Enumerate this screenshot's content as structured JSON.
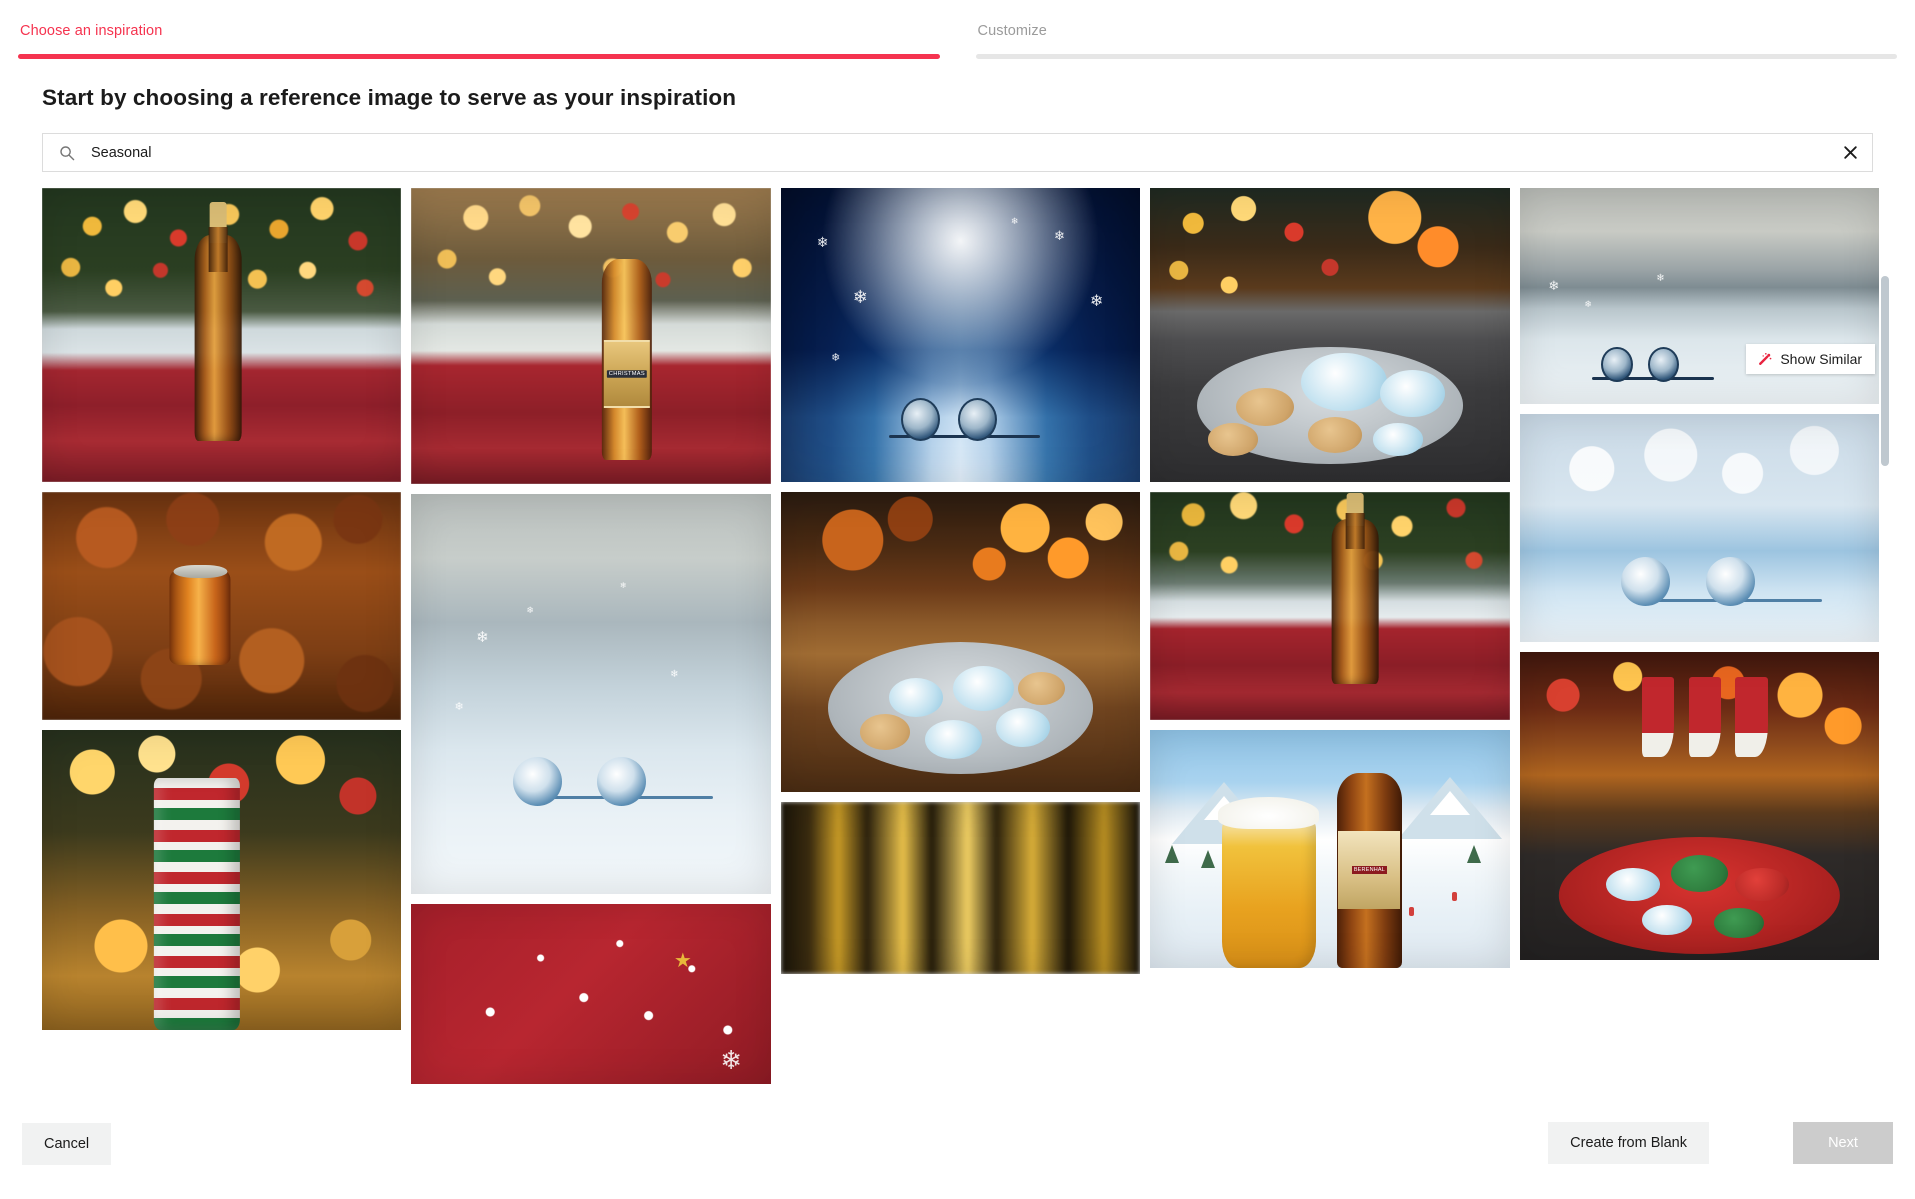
{
  "stepper": {
    "steps": [
      {
        "label": "Choose an inspiration",
        "state": "active",
        "accent": "#f5334f"
      },
      {
        "label": "Customize",
        "state": "inactive",
        "accent": "#e6e6e6"
      }
    ]
  },
  "page": {
    "title": "Start by choosing a reference image to serve as your inspiration"
  },
  "search": {
    "value": "Seasonal",
    "placeholder": "Search",
    "search_icon": "search-icon",
    "clear_icon": "close-icon",
    "clear_label": "Clear search"
  },
  "overlay": {
    "show_similar_label": "Show Similar",
    "show_similar_icon": "magic-wand-icon",
    "icon_color": "#e8233f"
  },
  "gallery": {
    "columns": [
      {
        "tiles": [
          {
            "name": "inspiration-tile-1",
            "alt": "Beer bottle on red plaid blanket in front of a lit Christmas tree"
          },
          {
            "name": "inspiration-tile-6",
            "alt": "Orange soda can nestled in autumn leaves"
          },
          {
            "name": "inspiration-tile-11",
            "alt": "Festive red and green patterned can with warm bokeh lights"
          }
        ]
      },
      {
        "tiles": [
          {
            "name": "inspiration-tile-2",
            "alt": "Christmas beer bottle with cookies and pinecones on plaid cloth",
            "label_text": "CHRISTMAS"
          },
          {
            "name": "inspiration-tile-7",
            "alt": "Earbuds lying in snow on a pale winter day"
          },
          {
            "name": "inspiration-tile-12",
            "alt": "Red holiday banner with ornaments, gold star and snowflake"
          }
        ]
      },
      {
        "tiles": [
          {
            "name": "inspiration-tile-3",
            "alt": "Blue snowy canyon with snowflakes and earbuds"
          },
          {
            "name": "inspiration-tile-8",
            "alt": "Plate of iced snowflake cookies by a fireplace and Christmas tree"
          },
          {
            "name": "inspiration-tile-13",
            "alt": "Blurred golden forest light"
          }
        ]
      },
      {
        "tiles": [
          {
            "name": "inspiration-tile-4",
            "alt": "Snowflake-iced cookies on a slate board with fireplace bokeh"
          },
          {
            "name": "inspiration-tile-9",
            "alt": "Beer bottle on plaid with cookies and Christmas tree lights"
          },
          {
            "name": "inspiration-tile-10",
            "alt": "Illustrated beer glass and bottle in a snowy mountain ski scene",
            "label_text": "BERENHAL"
          }
        ]
      },
      {
        "tiles": [
          {
            "name": "inspiration-tile-5",
            "alt": "Dark earbuds in snow with a soft gray winter background",
            "has_show_similar": true
          },
          {
            "name": "inspiration-tile-14",
            "alt": "Blue and white earbuds resting on bright snow"
          },
          {
            "name": "inspiration-tile-15",
            "alt": "Christmas stockings over a fireplace with a red plate of cookies"
          }
        ]
      }
    ]
  },
  "footer": {
    "cancel_label": "Cancel",
    "create_from_blank_label": "Create from Blank",
    "next_label": "Next",
    "next_disabled": true
  },
  "scrollbar": {
    "orientation": "vertical",
    "thumb_color": "#bfc8cf"
  }
}
